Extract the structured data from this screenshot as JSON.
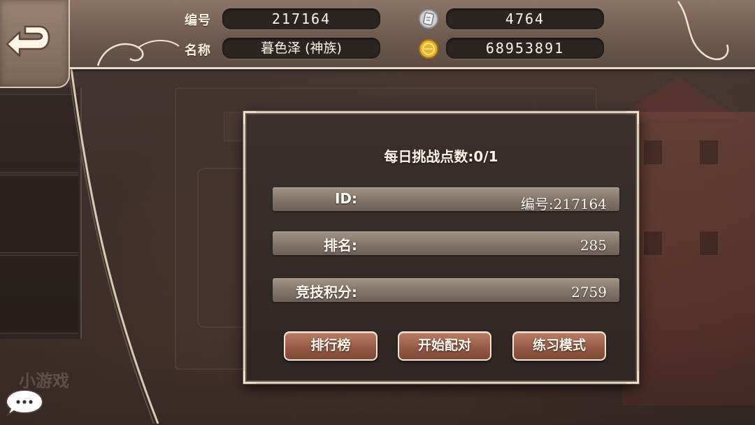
{
  "header": {
    "id_label": "编号",
    "id_value": "217164",
    "name_label": "名称",
    "name_value": "暮色泽 (神族)",
    "gem_value": "4764",
    "gold_value": "68953891"
  },
  "background": {
    "mini_game_label": "小游戏"
  },
  "dialog": {
    "title": "每日挑战点数:0/1",
    "rows": [
      {
        "key": "ID:",
        "value": "编号:217164"
      },
      {
        "key": "排名:",
        "value": "285"
      },
      {
        "key": "竞技积分:",
        "value": "2759"
      }
    ],
    "buttons": {
      "leaderboard": "排行榜",
      "start_match": "开始配对",
      "practice": "练习模式"
    }
  },
  "colors": {
    "header_bar": "#7a6455",
    "pill": "#2b2421",
    "dialog_bg": "#352b28",
    "button": "#a06a53",
    "frame": "#e6dcc6"
  },
  "icons": {
    "back": "back-arrow-icon",
    "gem": "silver-card-icon",
    "gold": "gold-coin-icon",
    "chat": "chat-bubble-icon"
  }
}
